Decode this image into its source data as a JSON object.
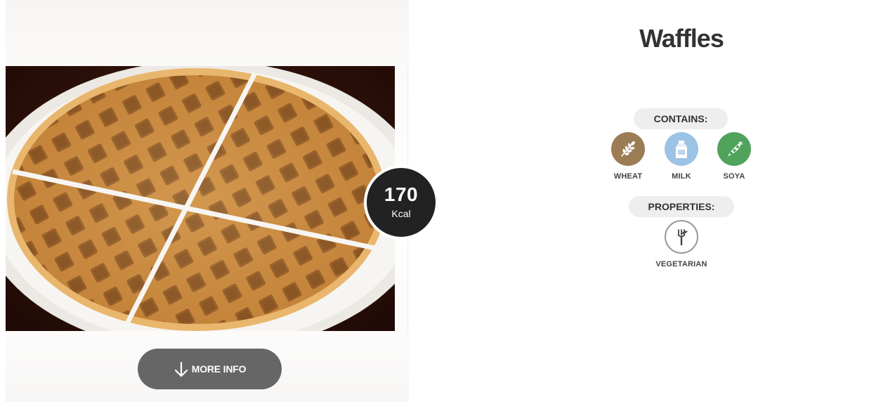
{
  "product": {
    "name": "Waffles",
    "kcal": {
      "value": "170",
      "unit": "Kcal"
    },
    "more_info_label": "MORE INFO",
    "more_info_icon": "arrow-down-icon"
  },
  "contains": {
    "heading": "CONTAINS:",
    "items": [
      {
        "label": "WHEAT",
        "icon": "wheat-icon",
        "color": "#9c7c55"
      },
      {
        "label": "MILK",
        "icon": "milk-carton-icon",
        "color": "#9cc3e6"
      },
      {
        "label": "SOYA",
        "icon": "soya-bean-icon",
        "color": "#4fa35c"
      }
    ]
  },
  "properties": {
    "heading": "PROPERTIES:",
    "items": [
      {
        "label": "VEGETARIAN",
        "icon": "vegetarian-fork-icon",
        "color": "#9a9a9a"
      }
    ]
  },
  "colors": {
    "title_text": "#333333",
    "badge_bg": "#222222",
    "button_bg": "#666666",
    "pill_bg": "#eeeeee"
  }
}
